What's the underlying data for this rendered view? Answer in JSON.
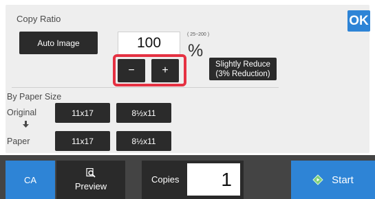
{
  "panel": {
    "title": "Copy Ratio",
    "ok_label": "OK",
    "auto_image_label": "Auto Image",
    "ratio_value": "100",
    "ratio_range": "( 25~200 )",
    "ratio_unit": "%",
    "minus_label": "−",
    "plus_label": "+",
    "reduce_line1": "Slightly Reduce",
    "reduce_line2": "(3% Reduction)"
  },
  "paper_size": {
    "section_label": "By Paper Size",
    "original_label": "Original",
    "paper_label": "Paper",
    "arrow": "🡇",
    "original_sizes": [
      "11x17",
      "8½x11"
    ],
    "paper_sizes": [
      "11x17",
      "8½x11"
    ]
  },
  "bottom_bar": {
    "ca_label": "CA",
    "preview_label": "Preview",
    "copies_label": "Copies",
    "copies_value": "1",
    "start_label": "Start"
  },
  "colors": {
    "accent": "#2e84d6",
    "highlight": "#e53142",
    "button_dark": "#2b2b2b",
    "panel_bg": "#eeeeee",
    "bar_bg": "#444444"
  },
  "icons": {
    "preview": "magnifier-document-icon",
    "start": "diamond-start-icon",
    "arrow": "arrow-down-icon"
  }
}
